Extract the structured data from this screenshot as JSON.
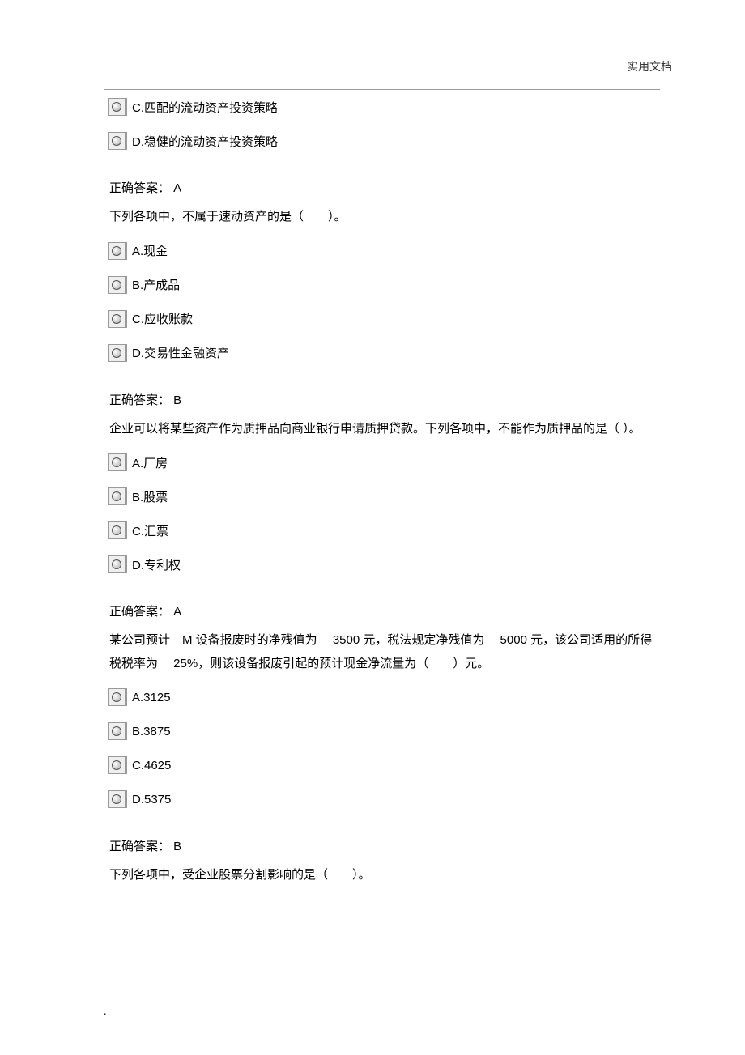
{
  "header": "实用文档",
  "footer": ".",
  "blocks": [
    {
      "type": "options",
      "items": [
        {
          "label": "C.匹配的流动资产投资策略"
        },
        {
          "label": "D.稳健的流动资产投资策略"
        }
      ]
    },
    {
      "type": "answer",
      "text": "正确答案： A"
    },
    {
      "type": "question",
      "text": "下列各项中，不属于速动资产的是（  ）。"
    },
    {
      "type": "options",
      "items": [
        {
          "label": "A.现金"
        },
        {
          "label": "B.产成品"
        },
        {
          "label": "C.应收账款"
        },
        {
          "label": "D.交易性金融资产"
        }
      ]
    },
    {
      "type": "answer",
      "text": "正确答案： B"
    },
    {
      "type": "question",
      "text": "企业可以将某些资产作为质押品向商业银行申请质押贷款。下列各项中，不能作为质押品的是（  ）。"
    },
    {
      "type": "options",
      "items": [
        {
          "label": "A.厂房"
        },
        {
          "label": "B.股票"
        },
        {
          "label": "C.汇票"
        },
        {
          "label": "D.专利权"
        }
      ]
    },
    {
      "type": "answer",
      "text": "正确答案： A"
    },
    {
      "type": "question",
      "text": "某公司预计 M 设备报废时的净残值为  3500 元，税法规定净残值为  5000 元，该公司适用的所得税税率为  25%，则该设备报废引起的预计现金净流量为（  ）元。"
    },
    {
      "type": "options",
      "items": [
        {
          "label": "A.3125"
        },
        {
          "label": "B.3875"
        },
        {
          "label": "C.4625"
        },
        {
          "label": "D.5375"
        }
      ]
    },
    {
      "type": "answer",
      "text": "正确答案： B"
    },
    {
      "type": "question",
      "text": "下列各项中，受企业股票分割影响的是（  ）。"
    }
  ]
}
